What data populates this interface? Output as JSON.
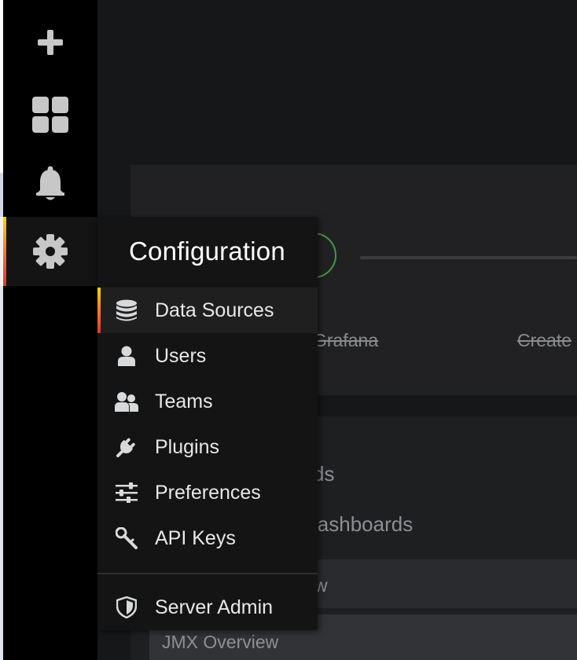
{
  "sidemenu": {
    "items": [
      {
        "name": "create",
        "icon": "plus-icon"
      },
      {
        "name": "dashboards",
        "icon": "apps-grid-icon"
      },
      {
        "name": "alerting",
        "icon": "bell-icon"
      },
      {
        "name": "configuration",
        "icon": "gear-icon",
        "active": true
      }
    ]
  },
  "dropdown": {
    "title": "Configuration",
    "items": [
      {
        "label": "Data Sources",
        "icon": "database-icon",
        "active": true
      },
      {
        "label": "Users",
        "icon": "user-icon"
      },
      {
        "label": "Teams",
        "icon": "users-icon"
      },
      {
        "label": "Plugins",
        "icon": "plug-icon"
      },
      {
        "label": "Preferences",
        "icon": "sliders-icon"
      },
      {
        "label": "API Keys",
        "icon": "key-icon"
      }
    ],
    "admin": {
      "label": "Server Admin",
      "icon": "shield-icon"
    }
  },
  "background": {
    "steps": [
      "Grafana",
      "Create"
    ],
    "headings": [
      "ds",
      "lashboards"
    ],
    "row1": "w",
    "row2": "JMX Overview"
  },
  "colors": {
    "accent_top": "#ffd500",
    "accent_bottom": "#e0352b",
    "success_ring": "#3e9b43",
    "menu_bg": "#141414"
  }
}
